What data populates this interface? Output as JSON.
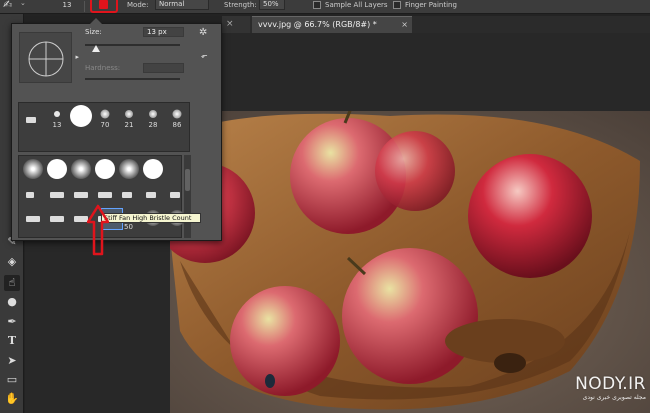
{
  "options_bar": {
    "brush_size": "13",
    "mode_label": "Mode:",
    "mode_value": "Normal",
    "strength_label": "Strength:",
    "strength_value": "50%",
    "sample_all_layers": "Sample All Layers",
    "finger_painting": "Finger Painting"
  },
  "document_tab": {
    "title": "vvvv.jpg @ 66.7% (RGB/8#) *",
    "close": "×"
  },
  "brush_panel": {
    "size_label": "Size:",
    "size_value": "13 px",
    "hardness_label": "Hardness:",
    "size_fraction": 0.12,
    "presets_row1": [
      "13",
      "70",
      "21",
      "28",
      "86"
    ],
    "tooltip": "Stiff Fan High Bristle Count",
    "tooltip_size": "50"
  },
  "colors": {
    "annotation_red": "#e0141c",
    "panel_bg": "#535353"
  },
  "watermark": {
    "brand": "NODY.IR",
    "tagline": "مجله تصویری خبری نودی"
  }
}
